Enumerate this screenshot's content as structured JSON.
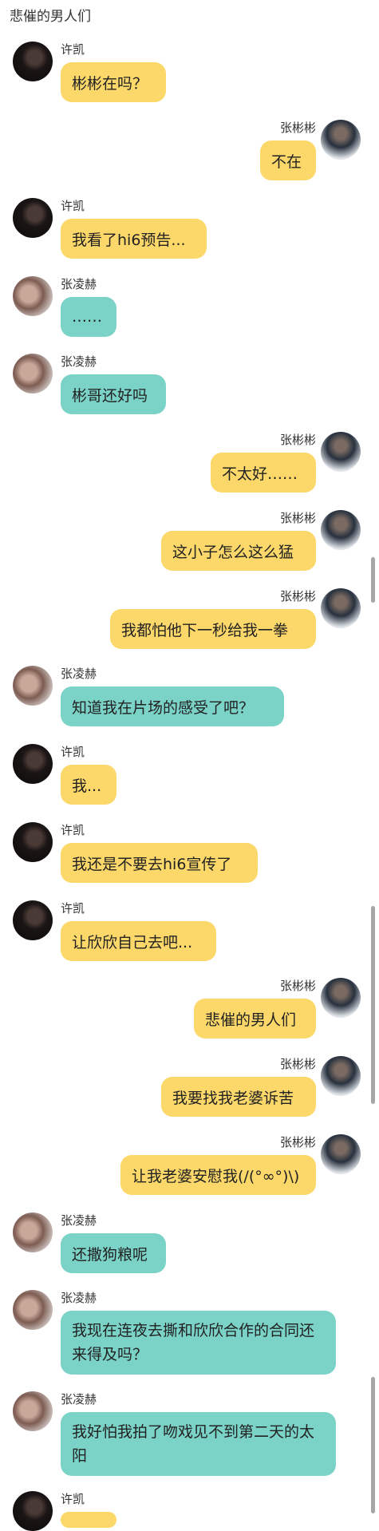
{
  "chat": {
    "title": "悲催的男人们"
  },
  "messages": [
    {
      "sender": "许凯",
      "side": "left",
      "color": "yellow",
      "avatar": "xk",
      "text": "彬彬在吗？"
    },
    {
      "sender": "张彬彬",
      "side": "right",
      "color": "yellow",
      "avatar": "zbb",
      "text": "不在"
    },
    {
      "sender": "许凯",
      "side": "left",
      "color": "yellow",
      "avatar": "xk",
      "text": "我看了hi6预告..."
    },
    {
      "sender": "张凌赫",
      "side": "left",
      "color": "teal",
      "avatar": "zlh",
      "text": "……"
    },
    {
      "sender": "张凌赫",
      "side": "left",
      "color": "teal",
      "avatar": "zlh",
      "text": "彬哥还好吗"
    },
    {
      "sender": "张彬彬",
      "side": "right",
      "color": "yellow",
      "avatar": "zbb",
      "text": "不太好……"
    },
    {
      "sender": "张彬彬",
      "side": "right",
      "color": "yellow",
      "avatar": "zbb",
      "text": "这小子怎么这么猛"
    },
    {
      "sender": "张彬彬",
      "side": "right",
      "color": "yellow",
      "avatar": "zbb",
      "text": "我都怕他下一秒给我一拳"
    },
    {
      "sender": "张凌赫",
      "side": "left",
      "color": "teal",
      "avatar": "zlh",
      "text": "知道我在片场的感受了吧？"
    },
    {
      "sender": "许凯",
      "side": "left",
      "color": "yellow",
      "avatar": "xk",
      "text": "我..."
    },
    {
      "sender": "许凯",
      "side": "left",
      "color": "yellow",
      "avatar": "xk",
      "text": "我还是不要去hi6宣传了"
    },
    {
      "sender": "许凯",
      "side": "left",
      "color": "yellow",
      "avatar": "xk",
      "text": "让欣欣自己去吧..."
    },
    {
      "sender": "张彬彬",
      "side": "right",
      "color": "yellow",
      "avatar": "zbb",
      "text": "悲催的男人们"
    },
    {
      "sender": "张彬彬",
      "side": "right",
      "color": "yellow",
      "avatar": "zbb",
      "text": "我要找我老婆诉苦"
    },
    {
      "sender": "张彬彬",
      "side": "right",
      "color": "yellow",
      "avatar": "zbb",
      "text": "让我老婆安慰我(/(°∞°)\\)"
    },
    {
      "sender": "张凌赫",
      "side": "left",
      "color": "teal",
      "avatar": "zlh",
      "text": "还撒狗粮呢"
    },
    {
      "sender": "张凌赫",
      "side": "left",
      "color": "teal",
      "avatar": "zlh",
      "text": "我现在连夜去撕和欣欣合作的合同还来得及吗？"
    },
    {
      "sender": "张凌赫",
      "side": "left",
      "color": "teal",
      "avatar": "zlh",
      "text": "我好怕我拍了吻戏见不到第二天的太阳"
    },
    {
      "sender": "许凯",
      "side": "left",
      "color": "yellow",
      "avatar": "xk",
      "text": ""
    }
  ]
}
